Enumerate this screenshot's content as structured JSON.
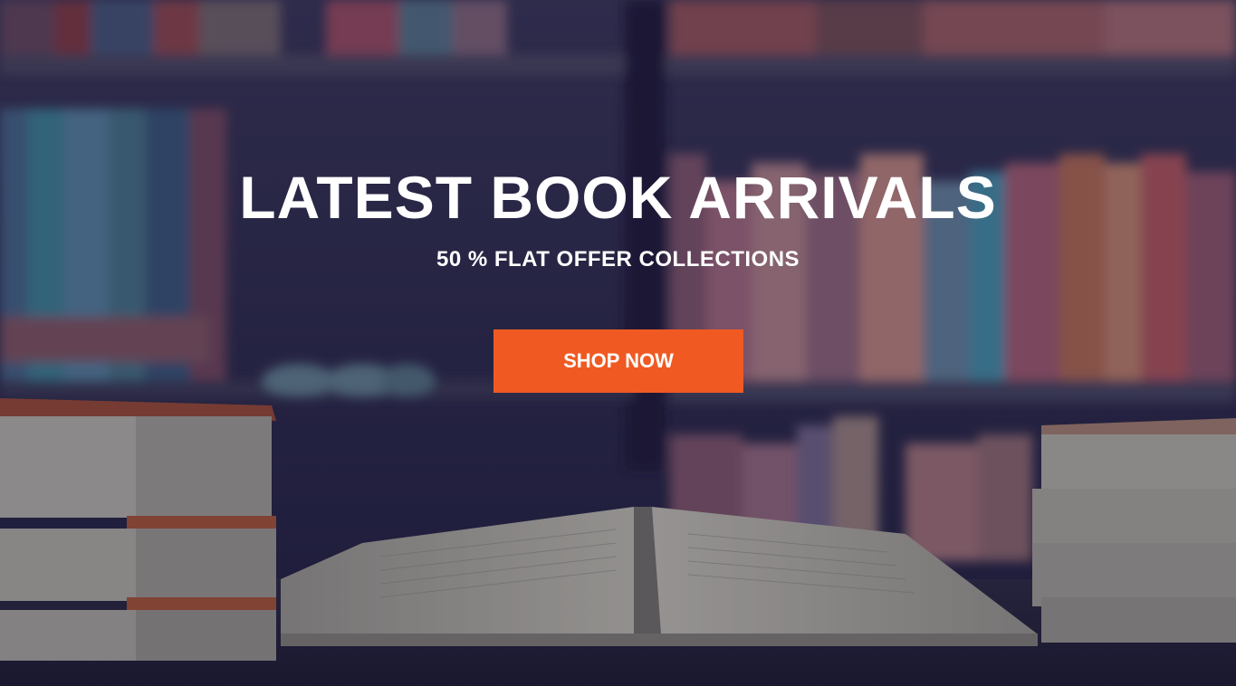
{
  "hero": {
    "headline": "LATEST BOOK ARRIVALS",
    "subheadline": "50 % FLAT OFFER COLLECTIONS",
    "cta_label": "SHOP NOW"
  },
  "colors": {
    "cta_background": "#F05A22",
    "overlay": "#19193C",
    "text": "#FFFFFF"
  }
}
